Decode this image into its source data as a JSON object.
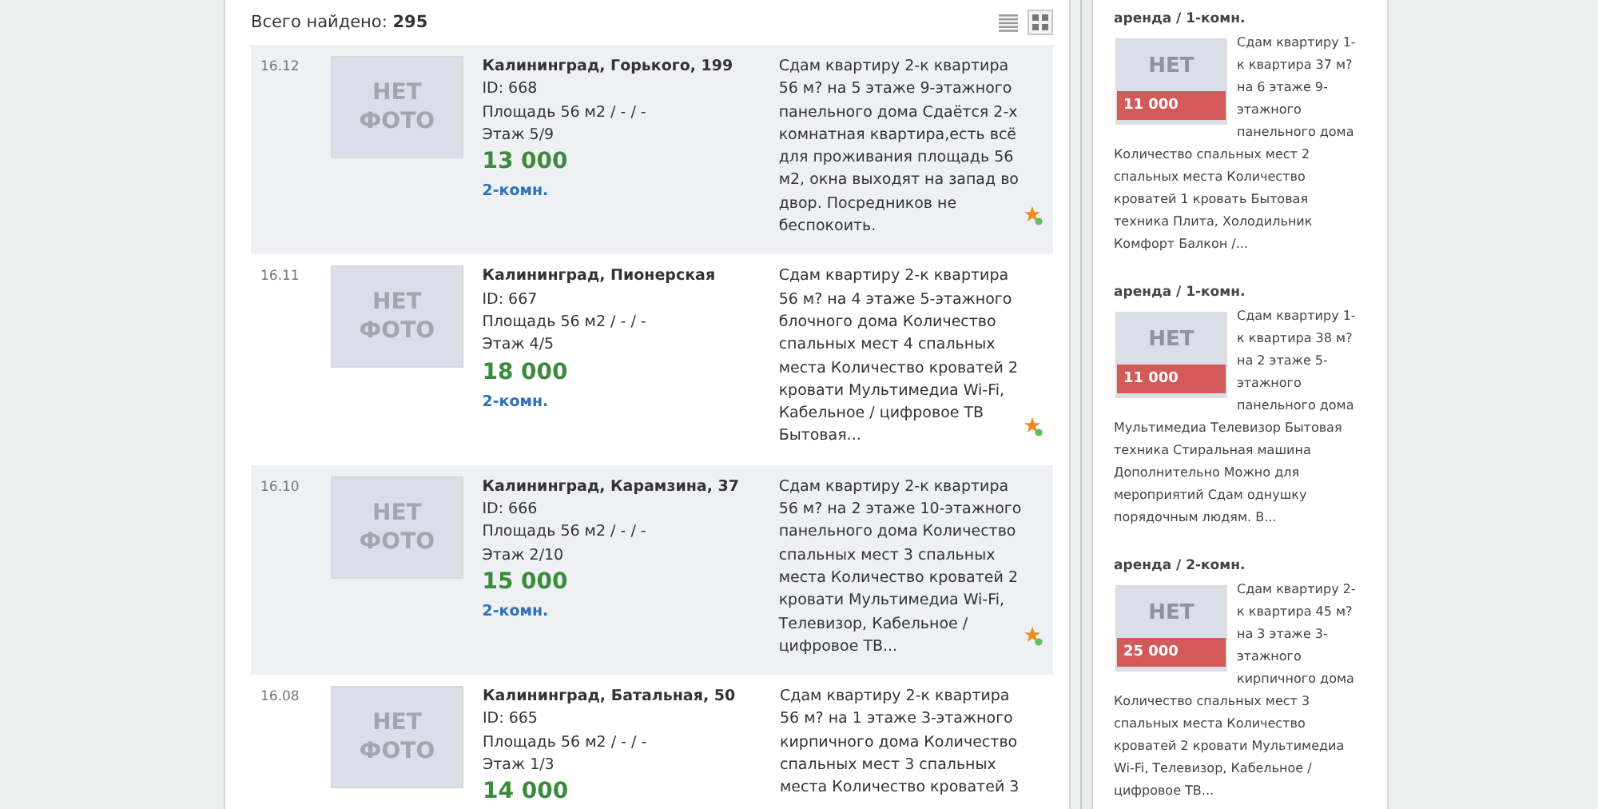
{
  "results_header": {
    "label": "Всего найдено:",
    "count": "295"
  },
  "view_buttons": [
    {
      "kind": "list",
      "selected": false
    },
    {
      "kind": "grid",
      "selected": true
    }
  ],
  "listings": [
    {
      "date": "16.12",
      "photo_label": "НЕТ ФОТО",
      "title": "Калининград, Горького, 199",
      "id": "ID: 668",
      "area": "Площадь 56 м2 / - / -",
      "floor": "Этаж 5/9",
      "price": "13 000",
      "rooms": "2-комн.",
      "description": "Сдам квартиру 2-к квартира 56 м? на 5 этаже 9-этажного панельного дома Сдаётся 2-х комнатная квартира,есть всё для проживания площадь 56 м2, окна выходят на запад во двор. Посредников не беспокоить.",
      "shaded": true
    },
    {
      "date": "16.11",
      "photo_label": "НЕТ ФОТО",
      "title": "Калининград, Пионерская",
      "id": "ID: 667",
      "area": "Площадь 56 м2 / - / -",
      "floor": "Этаж 4/5",
      "price": "18 000",
      "rooms": "2-комн.",
      "description": "Сдам квартиру 2-к квартира 56 м? на 4 этаже 5-этажного блочного дома Количество спальных мест 4 спальных места Количество кроватей 2 кровати Мультимедиа Wi-Fi, Кабельное / цифровое ТВ Бытовая...",
      "shaded": false
    },
    {
      "date": "16.10",
      "photo_label": "НЕТ ФОТО",
      "title": "Калининград, Карамзина, 37",
      "id": "ID: 666",
      "area": "Площадь 56 м2 / - / -",
      "floor": "Этаж 2/10",
      "price": "15 000",
      "rooms": "2-комн.",
      "description": "Сдам квартиру 2-к квартира 56 м? на 2 этаже 10-этажного панельного дома Количество спальных мест 3 спальных места Количество кроватей 2 кровати Мультимедиа Wi-Fi, Телевизор, Кабельное / цифровое ТВ...",
      "shaded": true
    },
    {
      "date": "16.08",
      "photo_label": "НЕТ ФОТО",
      "title": "Калининград, Батальная, 50",
      "id": "ID: 665",
      "area": "Площадь 56 м2 / - / -",
      "floor": "Этаж 1/3",
      "price": "14 000",
      "description": "Сдам квартиру 2-к квартира 56 м? на 1 этаже 3-этажного кирпичного дома Количество спальных мест 3 спальных места Количество кроватей 3",
      "shaded": false
    }
  ],
  "sidebar": {
    "items": [
      {
        "category": "аренда / 1-комн.",
        "photo_label": "НЕТ",
        "price": "11 000",
        "description_beside": "Сдам квартиру 1-к квартира 37 м? на 6 этаже 9-этажного панельного дома",
        "description_below": "Количество спальных мест 2 спальных места Количество кроватей 1 кровать Бытовая техника Плита, Холодильник Комфорт Балкон /..."
      },
      {
        "category": "аренда / 1-комн.",
        "photo_label": "НЕТ",
        "price": "11 000",
        "description_beside": "Сдам квартиру 1-к квартира 38 м? на 2 этаже 5-этажного панельного дома",
        "description_below": "Мультимедиа Телевизор Бытовая техника Стиральная машина Дополнительно Можно для мероприятий Сдам однушку порядочным людям. В..."
      },
      {
        "category": "аренда / 2-комн.",
        "photo_label": "НЕТ",
        "price": "25 000",
        "description_beside": "Сдам квартиру 2-к квартира 45 м? на 3 этаже 3-этажного кирпичного дома",
        "description_below": "Количество спальных мест 3 спальных места Количество кроватей 2 кровати Мультимедиа Wi-Fi, Телевизор, Кабельное / цифровое ТВ..."
      }
    ]
  }
}
